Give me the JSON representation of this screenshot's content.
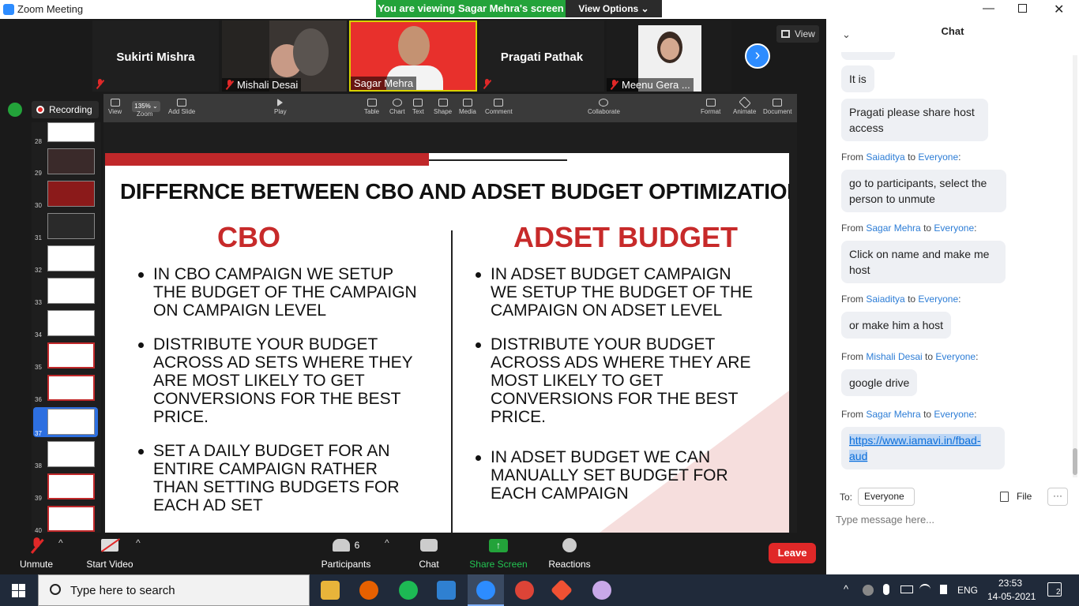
{
  "window": {
    "title": "Zoom Meeting"
  },
  "share_banner": {
    "viewing": "You are viewing Sagar Mehra's screen",
    "view_options": "View Options ⌄"
  },
  "gallery": {
    "view_label": "View",
    "participants": [
      {
        "name": "Sukirti Mishra"
      },
      {
        "name": "Mishali Desai"
      },
      {
        "name": "Sagar Mehra"
      },
      {
        "name": "Pragati Pathak"
      },
      {
        "name": "Meenu Gera ..."
      }
    ]
  },
  "recording": {
    "label": "Recording"
  },
  "keynote": {
    "toolbar": [
      "View",
      "Zoom",
      "Add Slide",
      "Play",
      "Table",
      "Chart",
      "Text",
      "Shape",
      "Media",
      "Comment",
      "Collaborate",
      "Format",
      "Animate",
      "Document"
    ],
    "zoom_value": "135% ⌄"
  },
  "slide_nav": {
    "numbers": [
      "28",
      "29",
      "30",
      "31",
      "32",
      "33",
      "34",
      "35",
      "36",
      "37",
      "38",
      "39",
      "40"
    ],
    "selected": "37"
  },
  "slide": {
    "title": "DIFFERNCE BETWEEN CBO AND ADSET BUDGET OPTIMIZATION",
    "left_heading": "CBO",
    "right_heading": "ADSET BUDGET",
    "left_bullets": [
      "IN CBO CAMPAIGN WE SETUP THE BUDGET OF THE CAMPAIGN ON CAMPAIGN LEVEL",
      "DISTRIBUTE YOUR BUDGET ACROSS AD SETS WHERE THEY ARE MOST LIKELY TO GET CONVERSIONS FOR THE BEST PRICE.",
      "SET A DAILY BUDGET FOR AN ENTIRE CAMPAIGN RATHER THAN SETTING BUDGETS FOR EACH AD SET"
    ],
    "right_bullets": [
      "IN ADSET BUDGET CAMPAIGN WE SETUP THE BUDGET OF THE CAMPAIGN ON ADSET LEVEL",
      "DISTRIBUTE YOUR BUDGET ACROSS ADS WHERE THEY ARE MOST LIKELY TO GET CONVERSIONS FOR THE BEST PRICE.",
      "IN ADSET BUDGET WE CAN MANUALLY SET  BUDGET FOR EACH CAMPAIGN"
    ]
  },
  "bottom_toolbar": {
    "unmute": "Unmute",
    "start_video": "Start Video",
    "participants": "Participants",
    "participants_count": "6",
    "chat": "Chat",
    "share_screen": "Share Screen",
    "reactions": "Reactions",
    "leave": "Leave"
  },
  "chat": {
    "title": "Chat",
    "messages": [
      {
        "from": "",
        "to": "",
        "text": "It is"
      },
      {
        "from": "",
        "to": "",
        "text": "Pragati please share host access"
      },
      {
        "from": "Saiaditya",
        "to": "Everyone",
        "text": "go to participants, select the person to unmute"
      },
      {
        "from": "Sagar Mehra",
        "to": "Everyone",
        "text": "Click on name and make me host"
      },
      {
        "from": "Saiaditya",
        "to": "Everyone",
        "text": "or make him a host"
      },
      {
        "from": "Mishali Desai",
        "to": "Everyone",
        "text": "google drive"
      },
      {
        "from": "Sagar Mehra",
        "to": "Everyone",
        "text": "https://www.iamavi.in/fbad-aud"
      }
    ],
    "from_prefix": "From",
    "to_word": "to",
    "to_label": "To:",
    "recipient": "Everyone",
    "file_label": "File",
    "input_placeholder": "Type message here..."
  },
  "taskbar": {
    "search_placeholder": "Type here to search",
    "lang": "ENG",
    "time": "23:53",
    "date": "14-05-2021",
    "notifications": "2"
  }
}
